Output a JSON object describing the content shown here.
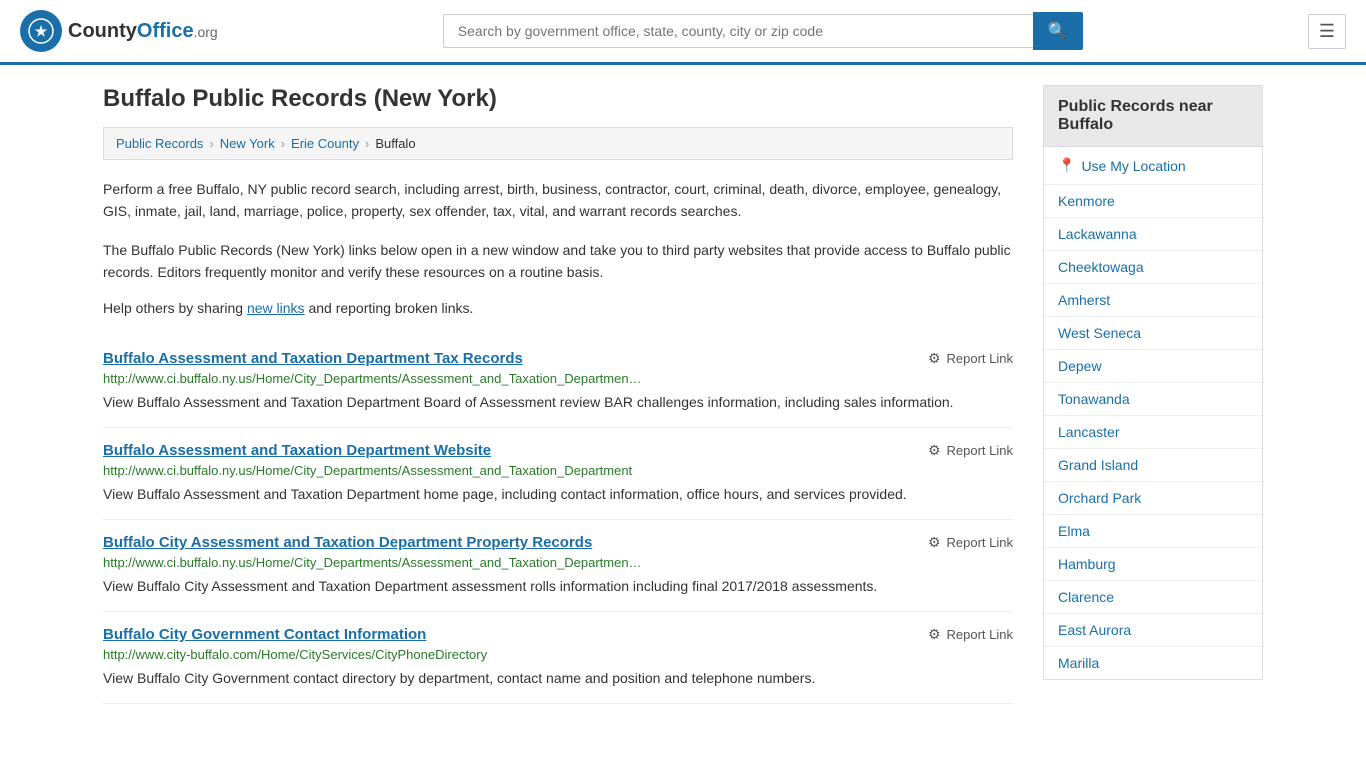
{
  "header": {
    "logo_text": "County",
    "logo_org": "Office",
    "logo_domain": ".org",
    "search_placeholder": "Search by government office, state, county, city or zip code",
    "menu_icon": "☰"
  },
  "page": {
    "title": "Buffalo Public Records (New York)",
    "breadcrumb": [
      {
        "label": "Public Records",
        "href": "#"
      },
      {
        "label": "New York",
        "href": "#"
      },
      {
        "label": "Erie County",
        "href": "#"
      },
      {
        "label": "Buffalo",
        "href": "#",
        "current": true
      }
    ],
    "description1": "Perform a free Buffalo, NY public record search, including arrest, birth, business, contractor, court, criminal, death, divorce, employee, genealogy, GIS, inmate, jail, land, marriage, police, property, sex offender, tax, vital, and warrant records searches.",
    "description2": "The Buffalo Public Records (New York) links below open in a new window and take you to third party websites that provide access to Buffalo public records. Editors frequently monitor and verify these resources on a routine basis.",
    "help_text_prefix": "Help others by sharing ",
    "help_link": "new links",
    "help_text_suffix": " and reporting broken links."
  },
  "records": [
    {
      "title": "Buffalo Assessment and Taxation Department Tax Records",
      "url": "http://www.ci.buffalo.ny.us/Home/City_Departments/Assessment_and_Taxation_Departmen…",
      "description": "View Buffalo Assessment and Taxation Department Board of Assessment review BAR challenges information, including sales information.",
      "report_label": "Report Link"
    },
    {
      "title": "Buffalo Assessment and Taxation Department Website",
      "url": "http://www.ci.buffalo.ny.us/Home/City_Departments/Assessment_and_Taxation_Department",
      "description": "View Buffalo Assessment and Taxation Department home page, including contact information, office hours, and services provided.",
      "report_label": "Report Link"
    },
    {
      "title": "Buffalo City Assessment and Taxation Department Property Records",
      "url": "http://www.ci.buffalo.ny.us/Home/City_Departments/Assessment_and_Taxation_Departmen…",
      "description": "View Buffalo City Assessment and Taxation Department assessment rolls information including final 2017/2018 assessments.",
      "report_label": "Report Link"
    },
    {
      "title": "Buffalo City Government Contact Information",
      "url": "http://www.city-buffalo.com/Home/CityServices/CityPhoneDirectory",
      "description": "View Buffalo City Government contact directory by department, contact name and position and telephone numbers.",
      "report_label": "Report Link"
    }
  ],
  "sidebar": {
    "title": "Public Records near Buffalo",
    "use_location_label": "Use My Location",
    "nearby": [
      "Kenmore",
      "Lackawanna",
      "Cheektowaga",
      "Amherst",
      "West Seneca",
      "Depew",
      "Tonawanda",
      "Lancaster",
      "Grand Island",
      "Orchard Park",
      "Elma",
      "Hamburg",
      "Clarence",
      "East Aurora",
      "Marilla"
    ]
  }
}
